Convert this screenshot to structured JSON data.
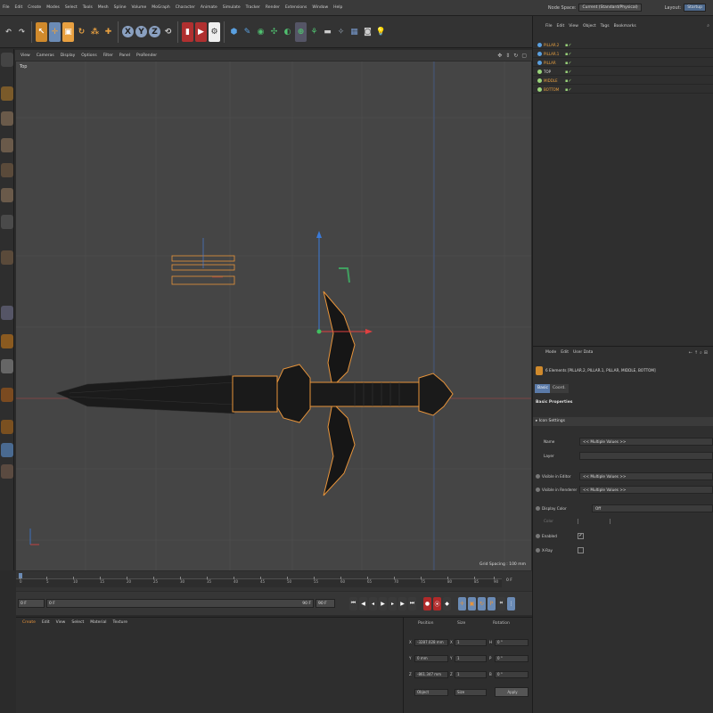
{
  "menubar": {
    "items": [
      "File",
      "Edit",
      "Create",
      "Modes",
      "Select",
      "Tools",
      "Mesh",
      "Spline",
      "Volume",
      "MoGraph",
      "Character",
      "Animate",
      "Simulate",
      "Tracker",
      "Render",
      "Extensions",
      "Window",
      "Help"
    ],
    "node_space_label": "Node Space:",
    "node_space_value": "Current (Standard/Physical)",
    "layout_label": "Layout:",
    "layout_value": "Startup"
  },
  "toolbar": {
    "axis_buttons": [
      "X",
      "Y",
      "Z"
    ]
  },
  "viewport": {
    "menu": [
      "View",
      "Cameras",
      "Display",
      "Options",
      "Filter",
      "Panel",
      "ProRender"
    ],
    "label": "Top",
    "grid_spacing": "Grid Spacing : 100 mm"
  },
  "timeline": {
    "ticks": [
      "0",
      "5",
      "10",
      "15",
      "20",
      "25",
      "30",
      "35",
      "40",
      "45",
      "50",
      "55",
      "60",
      "65",
      "70",
      "75",
      "80",
      "85",
      "90"
    ],
    "end_frame": "0 F"
  },
  "transport": {
    "start_field": "0 F",
    "range_start": "0 F",
    "range_end": "90 F",
    "end_field": "90 F"
  },
  "material_manager": {
    "menu": [
      "Create",
      "Edit",
      "View",
      "Select",
      "Material",
      "Texture"
    ]
  },
  "coordinates": {
    "headers": [
      "Position",
      "Size",
      "Rotation"
    ],
    "rows": [
      {
        "axis_p": "X",
        "pos": "-3287.028 mm",
        "axis_s": "X",
        "size": "1",
        "axis_r": "H",
        "rot": "0 °"
      },
      {
        "axis_p": "Y",
        "pos": "0 mm",
        "axis_s": "Y",
        "size": "1",
        "axis_r": "P",
        "rot": "0 °"
      },
      {
        "axis_p": "Z",
        "pos": "-861.347 mm",
        "axis_s": "Z",
        "size": "1",
        "axis_r": "B",
        "rot": "0 °"
      }
    ],
    "mode1": "Object",
    "mode2": "Size",
    "apply": "Apply"
  },
  "object_manager": {
    "menu": [
      "File",
      "Edit",
      "View",
      "Object",
      "Tags",
      "Bookmarks"
    ],
    "objects": [
      {
        "name": "PILLAR.2",
        "color": "#5aa0e0"
      },
      {
        "name": "PILLAR.1",
        "color": "#5aa0e0"
      },
      {
        "name": "PILLAR",
        "color": "#5aa0e0"
      },
      {
        "name": "TOP",
        "color": "#9ad47a"
      },
      {
        "name": "MIDDLE",
        "color": "#9ad47a"
      },
      {
        "name": "BOTTOM",
        "color": "#9ad47a"
      }
    ]
  },
  "attributes": {
    "menu": [
      "Mode",
      "Edit",
      "User Data"
    ],
    "selection": "6 Elements [PILLAR.2, PILLAR.1, PILLAR, MIDDLE, BOTTOM]",
    "tabs": [
      "Basic",
      "Coord."
    ],
    "section": "Basic Properties",
    "subsection": "Icon Settings",
    "fields": [
      {
        "label": "Name",
        "value": "<< Multiple Values >>"
      },
      {
        "label": "Layer",
        "value": ""
      },
      {
        "label": "Visible in Editor",
        "value": "<< Multiple Values >>"
      },
      {
        "label": "Visible in Renderer",
        "value": "<< Multiple Values >>"
      },
      {
        "label": "Display Color",
        "value": "Off"
      },
      {
        "label": "Color",
        "value": ""
      },
      {
        "label": "Enabled",
        "value": "✓"
      },
      {
        "label": "X-Ray",
        "value": ""
      }
    ]
  },
  "colors": {
    "accent": "#6b8bb5",
    "selection_orange": "#e8943a",
    "axis_red": "#e04040",
    "axis_green": "#40c060",
    "axis_blue": "#4080e0"
  }
}
